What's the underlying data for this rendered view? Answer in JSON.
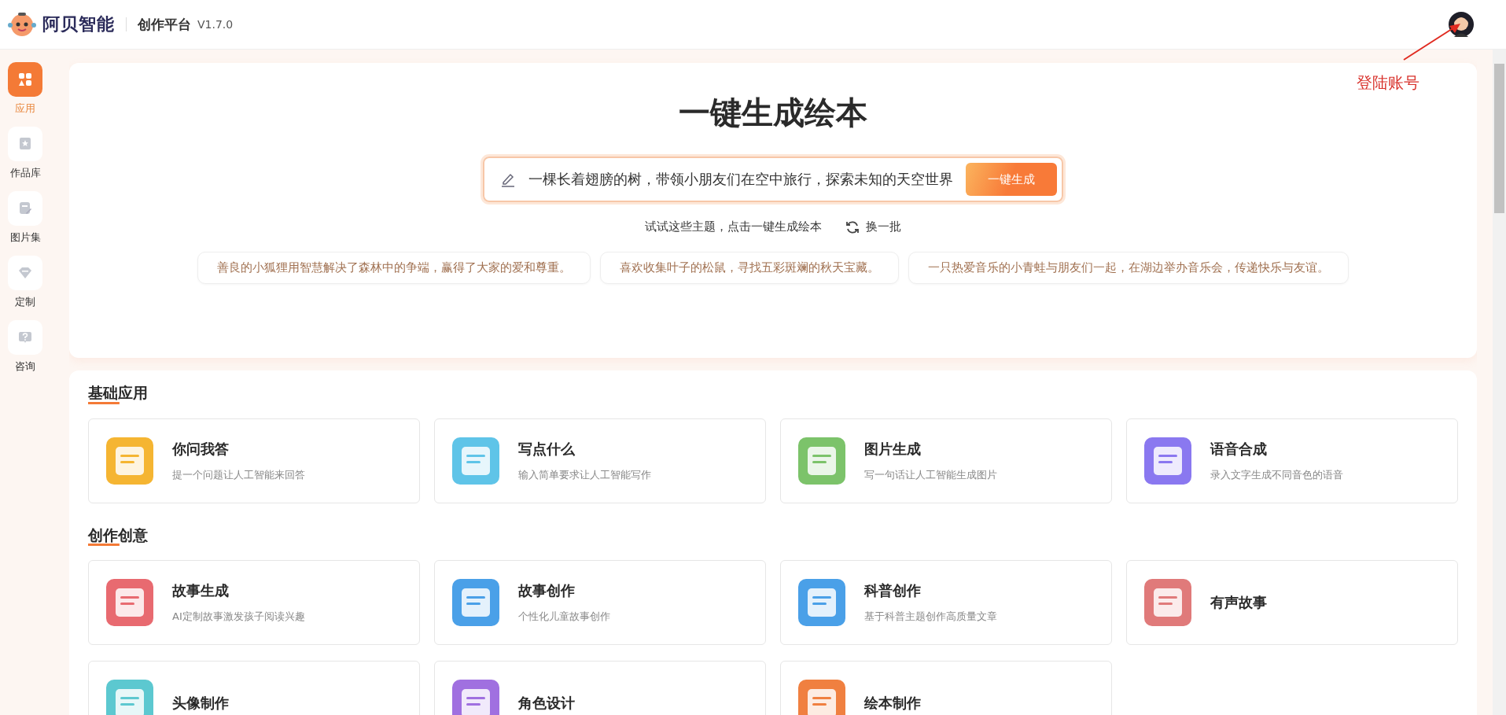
{
  "header": {
    "brand": "阿贝智能",
    "platform": "创作平台",
    "version": "V1.7.0"
  },
  "annotation": {
    "text": "登陆账号"
  },
  "sidebar": {
    "items": [
      {
        "label": "应用",
        "selected": true
      },
      {
        "label": "作品库",
        "selected": false
      },
      {
        "label": "图片集",
        "selected": false
      },
      {
        "label": "定制",
        "selected": false
      },
      {
        "label": "咨询",
        "selected": false
      }
    ]
  },
  "hero": {
    "title": "一键生成绘本",
    "input_value": "一棵长着翅膀的树，带领小朋友们在空中旅行，探索未知的天空世界",
    "generate_button": "一键生成",
    "hint": "试试这些主题，点击一键生成绘本",
    "refresh_button": "换一批",
    "topics": [
      "善良的小狐狸用智慧解决了森林中的争端，赢得了大家的爱和尊重。",
      "喜欢收集叶子的松鼠，寻找五彩斑斓的秋天宝藏。",
      "一只热爱音乐的小青蛙与朋友们一起，在湖边举办音乐会，传递快乐与友谊。"
    ]
  },
  "sections": [
    {
      "title": "基础应用",
      "apps": [
        {
          "name": "你问我答",
          "desc": "提一个问题让人工智能来回答"
        },
        {
          "name": "写点什么",
          "desc": "输入简单要求让人工智能写作"
        },
        {
          "name": "图片生成",
          "desc": "写一句话让人工智能生成图片"
        },
        {
          "name": "语音合成",
          "desc": "录入文字生成不同音色的语音"
        }
      ]
    },
    {
      "title": "创作创意",
      "apps": [
        {
          "name": "故事生成",
          "desc": "AI定制故事激发孩子阅读兴趣"
        },
        {
          "name": "故事创作",
          "desc": "个性化儿童故事创作"
        },
        {
          "name": "科普创作",
          "desc": "基于科普主题创作高质量文章"
        },
        {
          "name": "有声故事"
        },
        {
          "name": "头像制作"
        },
        {
          "name": "角色设计"
        },
        {
          "name": "绘本制作"
        }
      ]
    }
  ]
}
